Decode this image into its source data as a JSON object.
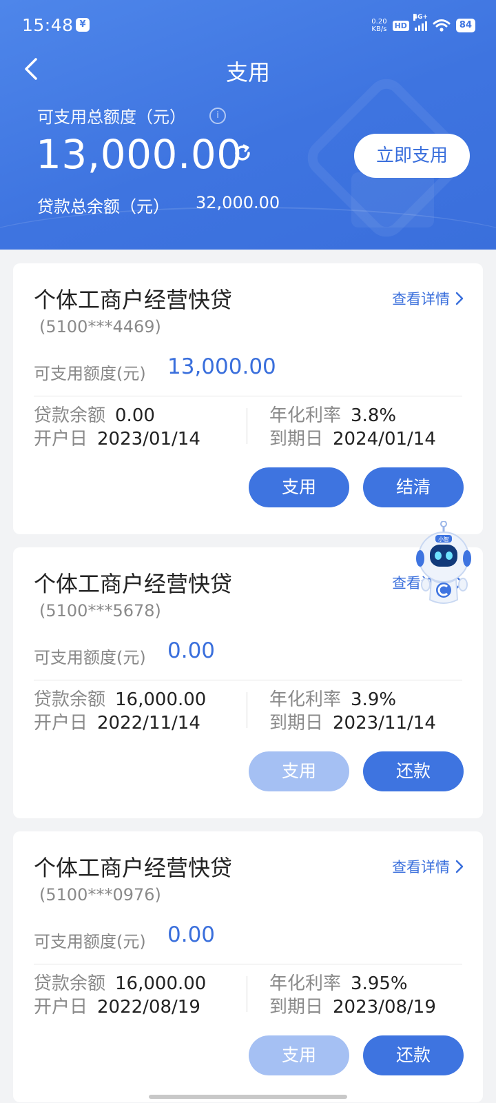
{
  "status_bar": {
    "time": "15:48",
    "net_speed": "0.20",
    "net_unit": "KB/s",
    "hd": "HD",
    "network": "4G+",
    "battery": "84"
  },
  "nav": {
    "title": "支用"
  },
  "summary": {
    "total_label": "可支用总额度（元）",
    "total_amount": "13,000.00",
    "use_now_label": "立即支用",
    "balance_label": "贷款总余额（元）",
    "balance_value": "32,000.00"
  },
  "labels": {
    "detail": "查看详情",
    "avail": "可支用额度(元)",
    "loan_balance": "贷款余额",
    "rate": "年化利率",
    "open_date": "开户日",
    "due_date": "到期日"
  },
  "loans": [
    {
      "title": "个体工商户经营快贷",
      "account": "(5100***4469)",
      "available": "13,000.00",
      "balance": "0.00",
      "rate": "3.8%",
      "open_date": "2023/01/14",
      "due_date": "2024/01/14",
      "btn_a": "支用",
      "btn_a_disabled": false,
      "btn_b": "结清"
    },
    {
      "title": "个体工商户经营快贷",
      "account": "(5100***5678)",
      "available": "0.00",
      "balance": "16,000.00",
      "rate": "3.9%",
      "open_date": "2022/11/14",
      "due_date": "2023/11/14",
      "btn_a": "支用",
      "btn_a_disabled": true,
      "btn_b": "还款"
    },
    {
      "title": "个体工商户经营快贷",
      "account": "(5100***0976)",
      "available": "0.00",
      "balance": "16,000.00",
      "rate": "3.95%",
      "open_date": "2022/08/19",
      "due_date": "2023/08/19",
      "btn_a": "支用",
      "btn_a_disabled": true,
      "btn_b": "还款"
    }
  ],
  "assistant": {
    "badge": "小智"
  },
  "colors": {
    "primary": "#3e74e0",
    "disabled": "#a5c0f3",
    "accent_text": "#3a6fdc"
  }
}
